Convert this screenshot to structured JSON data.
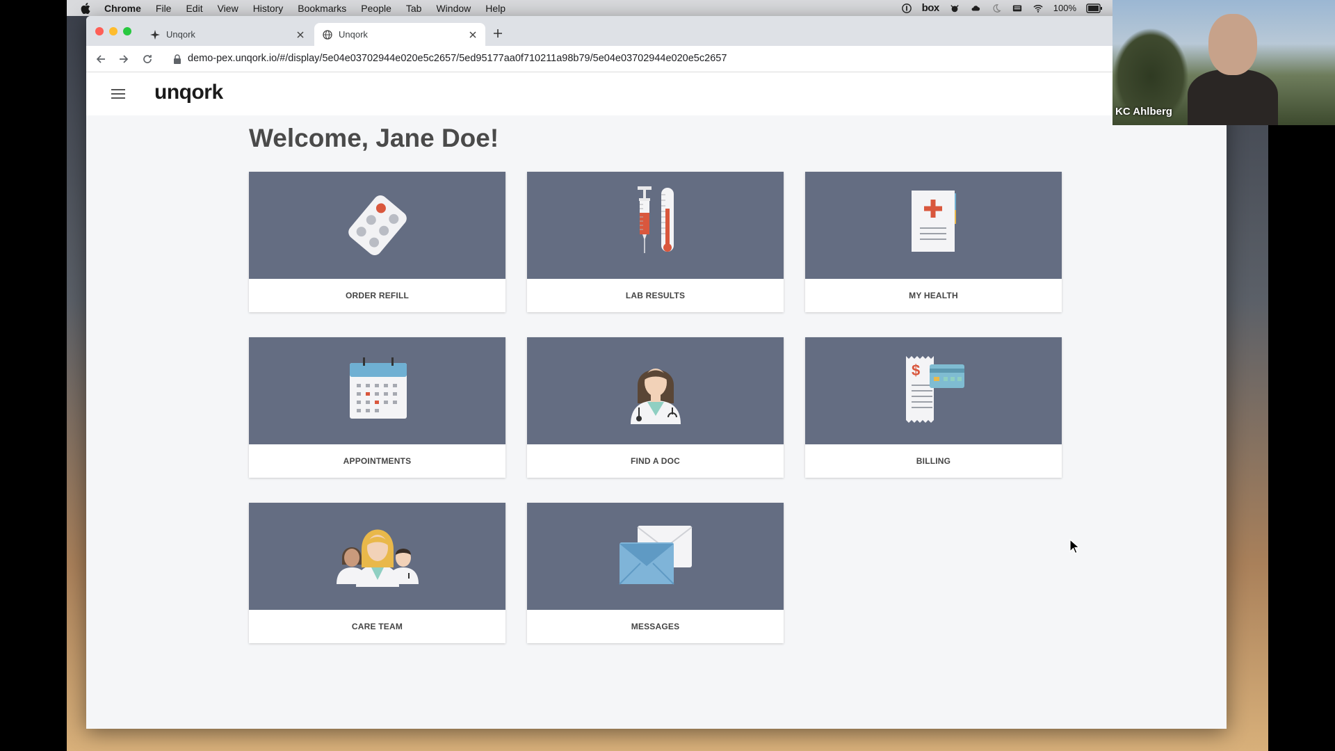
{
  "menubar": {
    "app_name": "Chrome",
    "items": [
      "File",
      "Edit",
      "View",
      "History",
      "Bookmarks",
      "People",
      "Tab",
      "Window",
      "Help"
    ],
    "status": {
      "box_label": "box",
      "battery": "100%"
    }
  },
  "browser": {
    "tabs": [
      {
        "title": "Unqork",
        "icon": "unqork-star-icon"
      },
      {
        "title": "Unqork",
        "icon": "globe-icon"
      }
    ],
    "url": "demo-pex.unqork.io/#/display/5e04e03702944e020e5c2657/5ed95177aa0f710211a98b79/5e04e03702944e020e5c2657"
  },
  "app": {
    "logo": "unqork",
    "welcome": "Welcome, Jane Doe!",
    "cards": [
      {
        "label": "ORDER REFILL",
        "icon": "pill-pack-icon"
      },
      {
        "label": "LAB RESULTS",
        "icon": "syringe-thermometer-icon"
      },
      {
        "label": "MY HEALTH",
        "icon": "medical-record-icon"
      },
      {
        "label": "APPOINTMENTS",
        "icon": "calendar-icon"
      },
      {
        "label": "FIND A DOC",
        "icon": "doctor-icon"
      },
      {
        "label": "BILLING",
        "icon": "bill-card-icon"
      },
      {
        "label": "CARE TEAM",
        "icon": "care-team-icon"
      },
      {
        "label": "MESSAGES",
        "icon": "envelope-icon"
      }
    ]
  },
  "video": {
    "participant_name": "KC Ahlberg"
  },
  "colors": {
    "card_art_bg": "#646d82",
    "accent_red": "#d9573d",
    "tab_bar": "#dee1e6"
  }
}
